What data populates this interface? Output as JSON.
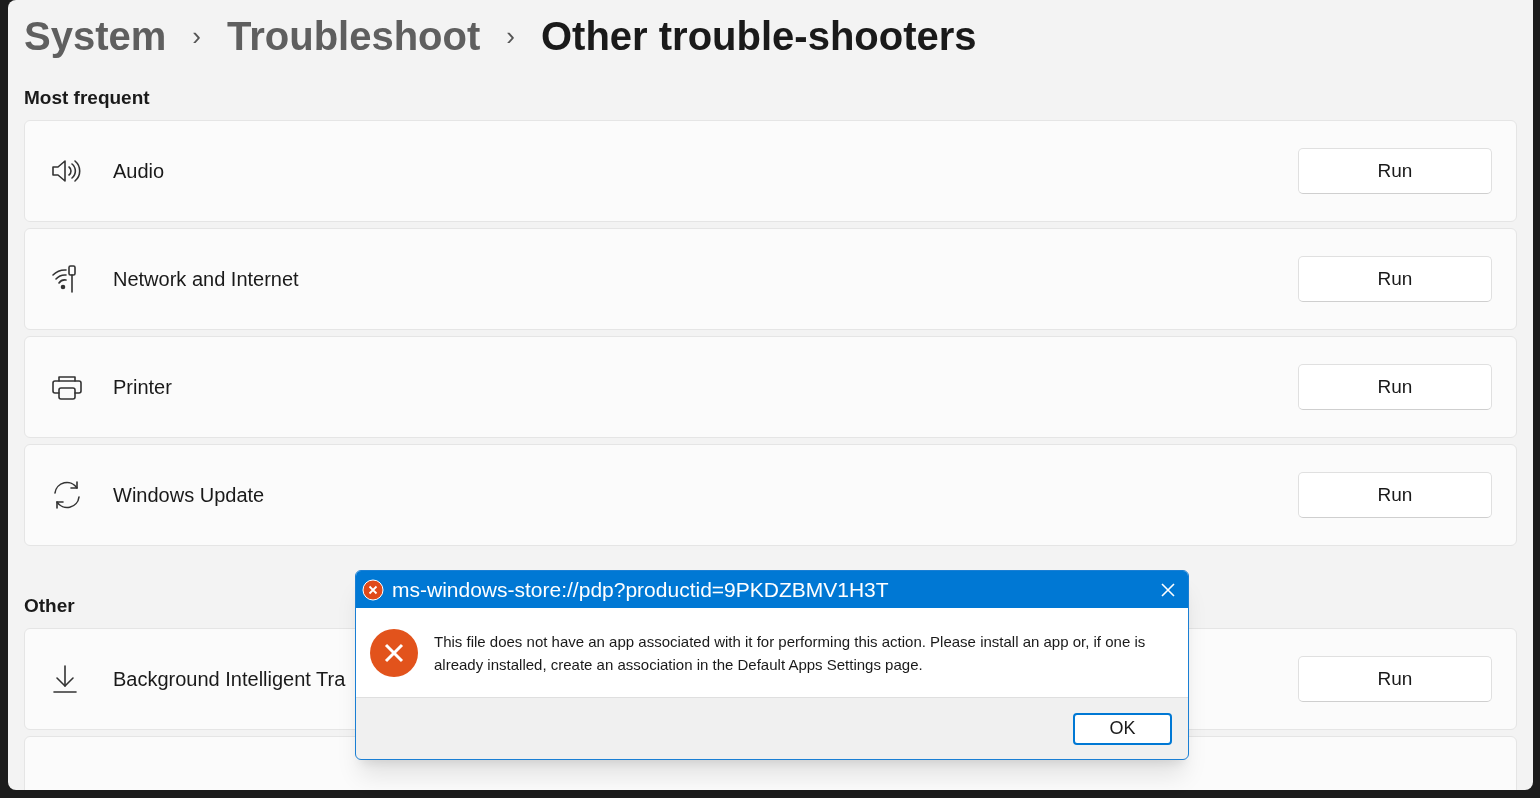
{
  "breadcrumb": [
    {
      "label": "System",
      "current": false
    },
    {
      "label": "Troubleshoot",
      "current": false
    },
    {
      "label": "Other trouble-shooters",
      "current": true
    }
  ],
  "breadcrumb_separator": "›",
  "sections": [
    {
      "title": "Most frequent",
      "items": [
        {
          "kind": "speaker",
          "label": "Audio",
          "button": "Run"
        },
        {
          "kind": "wifi",
          "label": "Network and Internet",
          "button": "Run"
        },
        {
          "kind": "printer",
          "label": "Printer",
          "button": "Run"
        },
        {
          "kind": "sync",
          "label": "Windows Update",
          "button": "Run"
        }
      ]
    },
    {
      "title": "Other",
      "items": [
        {
          "kind": "download",
          "label": "Background Intelligent Tra",
          "button": "Run"
        },
        {
          "kind": "blank"
        }
      ]
    }
  ],
  "dialog": {
    "title": "ms-windows-store://pdp?productid=9PKDZBMV1H3T",
    "message": "This file does not have an app associated with it for performing this action. Please install an app or, if one is already installed, create an association in the Default Apps Settings page.",
    "button": "OK"
  }
}
